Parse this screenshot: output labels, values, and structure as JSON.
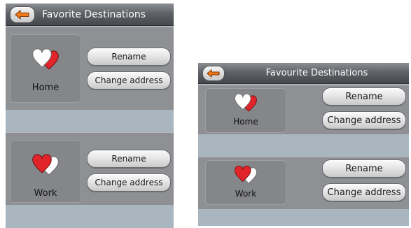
{
  "screen_left": {
    "title": "Favorite Destinations",
    "destinations": [
      {
        "name": "Home",
        "rename_label": "Rename",
        "change_address_label": "Change address"
      },
      {
        "name": "Work",
        "rename_label": "Rename",
        "change_address_label": "Change address"
      }
    ]
  },
  "screen_right": {
    "title": "Favourite Destinations",
    "destinations": [
      {
        "name": "Home",
        "rename_label": "Rename",
        "change_address_label": "Change address"
      },
      {
        "name": "Work",
        "rename_label": "Rename",
        "change_address_label": "Change address"
      }
    ]
  },
  "icons": {
    "back": "back-arrow-icon",
    "home": "hearts-icon (white front)",
    "work": "hearts-icon (red front)"
  },
  "colors": {
    "heart_red": "#e0242a",
    "heart_white": "#ffffff",
    "arrow_orange": "#f07a1a",
    "panel_gray": "#8f9094",
    "divider_blue_gray": "#a9b6bf"
  }
}
